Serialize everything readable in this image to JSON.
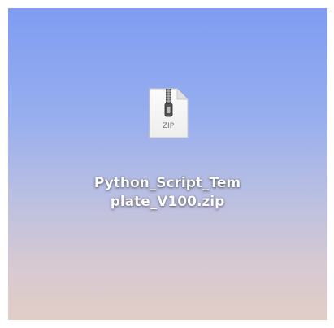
{
  "desktop": {
    "file": {
      "icon": "zip-archive-icon",
      "icon_badge": "ZIP",
      "name_line1": "Python_Script_Tem",
      "name_line2": "plate_V100.zip"
    }
  }
}
